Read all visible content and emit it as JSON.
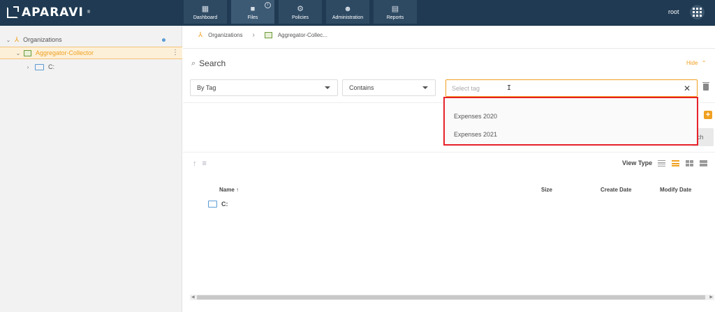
{
  "app": {
    "brand": "APARAVI",
    "trademark": "®",
    "user": "root"
  },
  "nav": [
    {
      "label": "Dashboard",
      "icon": "dashboard-icon"
    },
    {
      "label": "Files",
      "icon": "folder-icon",
      "active": true,
      "info": "i"
    },
    {
      "label": "Policies",
      "icon": "gear-icon"
    },
    {
      "label": "Administration",
      "icon": "users-icon"
    },
    {
      "label": "Reports",
      "icon": "clipboard-icon"
    }
  ],
  "sidebar": {
    "root": {
      "label": "Organizations",
      "icon": "organizations-icon"
    },
    "collector": {
      "label": "Aggregator-Collector",
      "icon": "collector-icon"
    },
    "drive": {
      "label": "C:",
      "icon": "folder-icon"
    }
  },
  "breadcrumb": {
    "root": "Organizations",
    "current": "Aggregator-Collec..."
  },
  "search": {
    "title": "Search",
    "hide_label": "Hide",
    "field_select": "By Tag",
    "operator_select": "Contains",
    "tag_placeholder": "Select tag",
    "options": [
      "Expenses 2020",
      "Expenses 2021"
    ],
    "search_button_partial": "ch"
  },
  "view": {
    "label": "View Type"
  },
  "table": {
    "columns": {
      "name": "Name",
      "size": "Size",
      "create": "Create Date",
      "modify": "Modify Date"
    },
    "rows": [
      {
        "name": "C:"
      }
    ]
  },
  "colors": {
    "accent": "#f0a020",
    "topbar": "#1f3a52",
    "highlight": "#e8222a"
  }
}
